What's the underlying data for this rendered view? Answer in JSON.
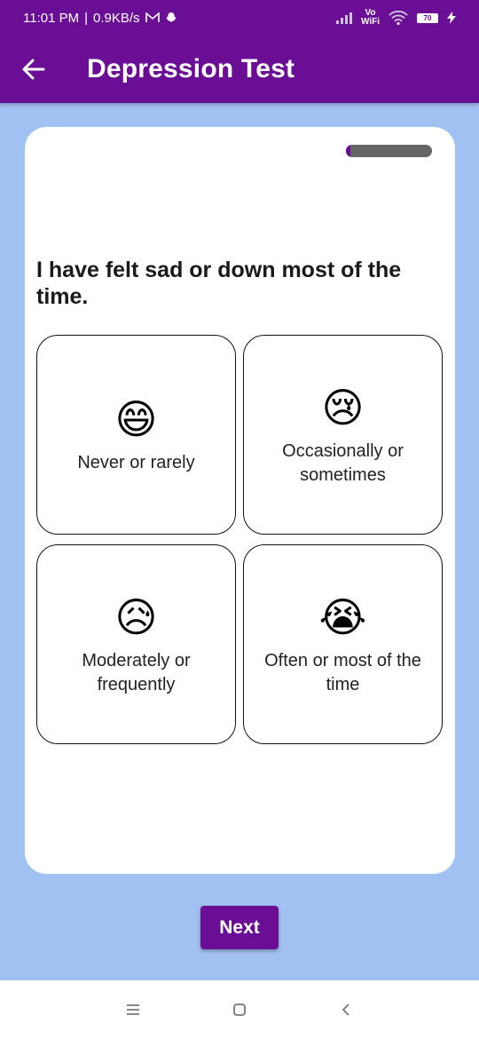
{
  "status_bar": {
    "time": "11:01 PM",
    "separator": "|",
    "net_speed": "0.9KB/s",
    "notif_icons": [
      "gmail-icon",
      "snapchat-icon"
    ],
    "vowifi_top": "Vo",
    "vowifi_bottom": "WiFi",
    "battery": "70"
  },
  "app_bar": {
    "title": "Depression Test",
    "back_icon": "arrow-left-icon"
  },
  "progress": {
    "fraction": 0.05
  },
  "question": "I have felt sad or down most of the time.",
  "options": [
    {
      "emoji": "😄",
      "label": "Never or rarely"
    },
    {
      "emoji": "😢",
      "label": "Occasionally or sometimes"
    },
    {
      "emoji": "😥",
      "label": "Moderately or frequently"
    },
    {
      "emoji": "😭",
      "label": "Often or most of the time"
    }
  ],
  "next_label": "Next",
  "nav": {
    "menu_icon": "menu-icon",
    "home_icon": "home-icon",
    "back_icon": "back-chevron-icon"
  },
  "colors": {
    "primary": "#6a0e96",
    "background": "#a2c1f3",
    "progress_track": "#666666"
  }
}
